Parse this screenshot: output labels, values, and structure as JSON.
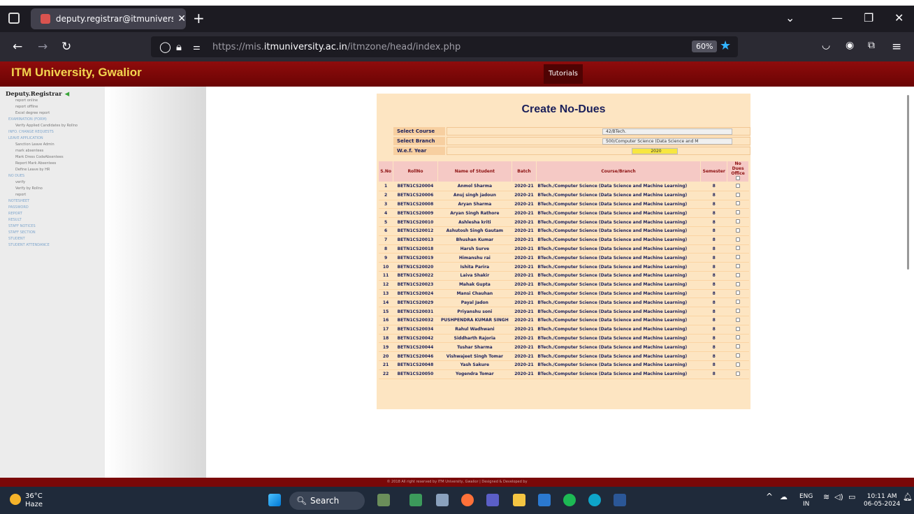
{
  "browser": {
    "tab_title": "deputy.registrar@itmuniversity.ac.in",
    "url_prefix": "https://mis.",
    "url_host": "itmuniversity.ac.in",
    "url_path": "/itmzone/head/index.php",
    "zoom": "60%"
  },
  "site": {
    "title": "ITM University, Gwalior",
    "nav_tutorials": "Tutorials"
  },
  "sidebar": {
    "user": "Deputy.Registrar",
    "items": [
      {
        "label": "report online",
        "type": "sub"
      },
      {
        "label": "report offline",
        "type": "sub"
      },
      {
        "label": "Excel degree report",
        "type": "sub"
      },
      {
        "label": "EXAMINATION (FORM)",
        "type": "head"
      },
      {
        "label": "Verify Applied Candidates by Rollno",
        "type": "sub"
      },
      {
        "label": "INFO. CHANGE REQUESTS",
        "type": "head"
      },
      {
        "label": "LEAVE APPLICATION",
        "type": "head"
      },
      {
        "label": "Sanction Leave Admin",
        "type": "sub"
      },
      {
        "label": "mark absentees",
        "type": "sub"
      },
      {
        "label": "Mark Dress CodeAbsentees",
        "type": "sub"
      },
      {
        "label": "Report Mark Absentees",
        "type": "sub"
      },
      {
        "label": "Define Leave by HR",
        "type": "sub"
      },
      {
        "label": "NO DUES",
        "type": "head"
      },
      {
        "label": "verify",
        "type": "sub"
      },
      {
        "label": "Verify by Rollno",
        "type": "sub"
      },
      {
        "label": "report",
        "type": "sub"
      },
      {
        "label": "NOTESHEET",
        "type": "head"
      },
      {
        "label": "PASSWORD",
        "type": "head"
      },
      {
        "label": "REPORT",
        "type": "head"
      },
      {
        "label": "RESULT",
        "type": "head"
      },
      {
        "label": "STAFF NOTICES",
        "type": "head"
      },
      {
        "label": "STAFF SECTION",
        "type": "head"
      },
      {
        "label": "STUDENT",
        "type": "head"
      },
      {
        "label": "STUDENT ATTENDANCE",
        "type": "head"
      }
    ]
  },
  "form": {
    "title": "Create No-Dues",
    "course_label": "Select Course",
    "course_value": "42/BTech.",
    "branch_label": "Select Branch",
    "branch_value": "500/Computer Science (Data Science and M",
    "year_label": "W.e.f. Year",
    "year_value": "2020"
  },
  "table": {
    "headers": [
      "S.No",
      "RollNo",
      "Name of Student",
      "Batch",
      "Course/Branch",
      "Semester",
      "No Dues Office"
    ],
    "rows": [
      [
        "1",
        "BETN1CS20004",
        "Anmol Sharma",
        "2020-21",
        "BTech./Computer Science (Data Science and Machine Learning)",
        "8"
      ],
      [
        "2",
        "BETN1CS20006",
        "Anuj singh jadoun",
        "2020-21",
        "BTech./Computer Science (Data Science and Machine Learning)",
        "8"
      ],
      [
        "3",
        "BETN1CS20008",
        "Aryan Sharma",
        "2020-21",
        "BTech./Computer Science (Data Science and Machine Learning)",
        "8"
      ],
      [
        "4",
        "BETN1CS20009",
        "Aryan Singh Rathore",
        "2020-21",
        "BTech./Computer Science (Data Science and Machine Learning)",
        "8"
      ],
      [
        "5",
        "BETN1CS20010",
        "Ashlesha kriti",
        "2020-21",
        "BTech./Computer Science (Data Science and Machine Learning)",
        "8"
      ],
      [
        "6",
        "BETN1CS20012",
        "Ashutosh Singh Gautam",
        "2020-21",
        "BTech./Computer Science (Data Science and Machine Learning)",
        "8"
      ],
      [
        "7",
        "BETN1CS20013",
        "Bhushan Kumar",
        "2020-21",
        "BTech./Computer Science (Data Science and Machine Learning)",
        "8"
      ],
      [
        "8",
        "BETN1CS20018",
        "Harsh Surve",
        "2020-21",
        "BTech./Computer Science (Data Science and Machine Learning)",
        "8"
      ],
      [
        "9",
        "BETN1CS20019",
        "Himanshu rai",
        "2020-21",
        "BTech./Computer Science (Data Science and Machine Learning)",
        "8"
      ],
      [
        "10",
        "BETN1CS20020",
        "Ishita Parira",
        "2020-21",
        "BTech./Computer Science (Data Science and Machine Learning)",
        "8"
      ],
      [
        "11",
        "BETN1CS20022",
        "Laiva Shakir",
        "2020-21",
        "BTech./Computer Science (Data Science and Machine Learning)",
        "8"
      ],
      [
        "12",
        "BETN1CS20023",
        "Mahak Gupta",
        "2020-21",
        "BTech./Computer Science (Data Science and Machine Learning)",
        "8"
      ],
      [
        "13",
        "BETN1CS20024",
        "Mansi Chauhan",
        "2020-21",
        "BTech./Computer Science (Data Science and Machine Learning)",
        "8"
      ],
      [
        "14",
        "BETN1CS20029",
        "Payal Jadon",
        "2020-21",
        "BTech./Computer Science (Data Science and Machine Learning)",
        "8"
      ],
      [
        "15",
        "BETN1CS20031",
        "Priyanshu soni",
        "2020-21",
        "BTech./Computer Science (Data Science and Machine Learning)",
        "8"
      ],
      [
        "16",
        "BETN1CS20032",
        "PUSHPENDRA KUMAR SINGH",
        "2020-21",
        "BTech./Computer Science (Data Science and Machine Learning)",
        "8"
      ],
      [
        "17",
        "BETN1CS20034",
        "Rahul Wadhwani",
        "2020-21",
        "BTech./Computer Science (Data Science and Machine Learning)",
        "8"
      ],
      [
        "18",
        "BETN1CS20042",
        "Siddharth Rajoria",
        "2020-21",
        "BTech./Computer Science (Data Science and Machine Learning)",
        "8"
      ],
      [
        "19",
        "BETN1CS20044",
        "Tushar Sharma",
        "2020-21",
        "BTech./Computer Science (Data Science and Machine Learning)",
        "8"
      ],
      [
        "20",
        "BETN1CS20046",
        "Vishwajeet Singh Tomar",
        "2020-21",
        "BTech./Computer Science (Data Science and Machine Learning)",
        "8"
      ],
      [
        "21",
        "BETN1CS20048",
        "Yash Sakure",
        "2020-21",
        "BTech./Computer Science (Data Science and Machine Learning)",
        "8"
      ],
      [
        "22",
        "BETN1CS20050",
        "Yogendra Tomar",
        "2020-21",
        "BTech./Computer Science (Data Science and Machine Learning)",
        "8"
      ]
    ]
  },
  "footer": "© 2018 All right reserved by ITM University, Gwalior | Designed & Developed by",
  "taskbar": {
    "temp": "36°C",
    "weather": "Haze",
    "search": "Search",
    "lang1": "ENG",
    "lang2": "IN",
    "time": "10:11 AM",
    "date": "06-05-2024"
  }
}
